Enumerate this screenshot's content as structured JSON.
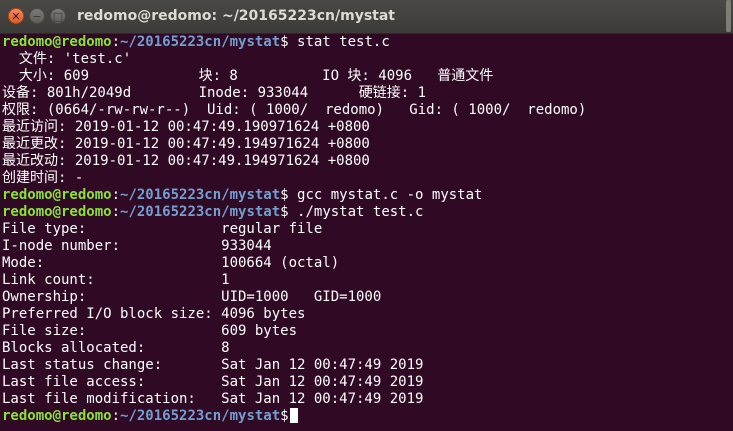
{
  "window": {
    "title": "redomo@redomo: ~/20165223cn/mystat",
    "close_glyph": "✕",
    "minimize_glyph": "−",
    "maximize_glyph": "□"
  },
  "terminal": {
    "lines": [
      {
        "type": "prompt",
        "user": "redomo@redomo",
        "sep": ":",
        "path": "~/20165223cn/mystat",
        "sign": "$ ",
        "cmd": "stat test.c"
      },
      {
        "type": "out",
        "text": "  文件: 'test.c'"
      },
      {
        "type": "out",
        "text": "  大小: 609             块: 8          IO 块: 4096   普通文件"
      },
      {
        "type": "out",
        "text": "设备: 801h/2049d        Inode: 933044      硬链接: 1"
      },
      {
        "type": "out",
        "text": "权限: (0664/-rw-rw-r--)  Uid: ( 1000/  redomo)   Gid: ( 1000/  redomo)"
      },
      {
        "type": "out",
        "text": "最近访问: 2019-01-12 00:47:49.190971624 +0800"
      },
      {
        "type": "out",
        "text": "最近更改: 2019-01-12 00:47:49.194971624 +0800"
      },
      {
        "type": "out",
        "text": "最近改动: 2019-01-12 00:47:49.194971624 +0800"
      },
      {
        "type": "out",
        "text": "创建时间: -"
      },
      {
        "type": "prompt",
        "user": "redomo@redomo",
        "sep": ":",
        "path": "~/20165223cn/mystat",
        "sign": "$ ",
        "cmd": "gcc mystat.c -o mystat"
      },
      {
        "type": "prompt",
        "user": "redomo@redomo",
        "sep": ":",
        "path": "~/20165223cn/mystat",
        "sign": "$ ",
        "cmd": "./mystat test.c"
      },
      {
        "type": "out",
        "text": "File type:                regular file"
      },
      {
        "type": "out",
        "text": "I-node number:            933044"
      },
      {
        "type": "out",
        "text": "Mode:                     100664 (octal)"
      },
      {
        "type": "out",
        "text": "Link count:               1"
      },
      {
        "type": "out",
        "text": "Ownership:                UID=1000   GID=1000"
      },
      {
        "type": "out",
        "text": "Preferred I/O block size: 4096 bytes"
      },
      {
        "type": "out",
        "text": "File size:                609 bytes"
      },
      {
        "type": "out",
        "text": "Blocks allocated:         8"
      },
      {
        "type": "out",
        "text": "Last status change:       Sat Jan 12 00:47:49 2019"
      },
      {
        "type": "out",
        "text": "Last file access:         Sat Jan 12 00:47:49 2019"
      },
      {
        "type": "out",
        "text": "Last file modification:   Sat Jan 12 00:47:49 2019"
      },
      {
        "type": "prompt",
        "user": "redomo@redomo",
        "sep": ":",
        "path": "~/20165223cn/mystat",
        "sign": "$",
        "cmd": "",
        "cursor": true
      }
    ]
  },
  "colors": {
    "background": "#300a24",
    "prompt_user": "#8ae234",
    "prompt_path": "#729fcf",
    "text": "#ffffff"
  }
}
